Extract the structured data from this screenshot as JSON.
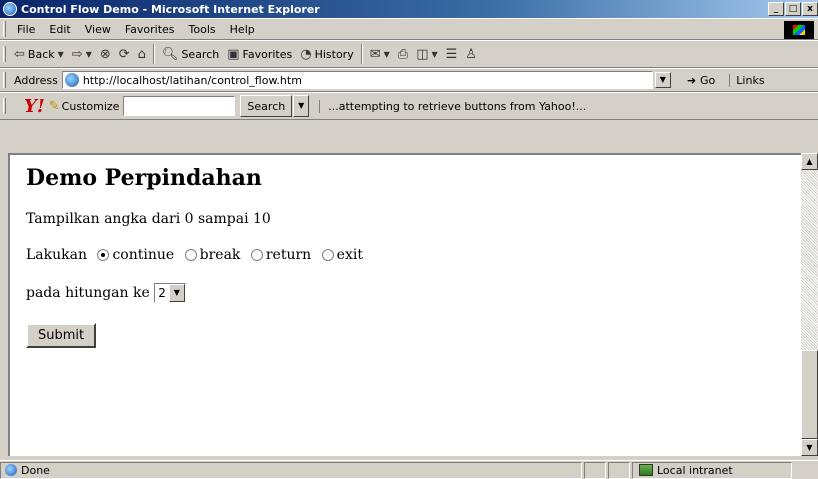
{
  "window": {
    "title": "Control Flow Demo - Microsoft Internet Explorer",
    "minimize": "_",
    "maximize": "□",
    "close": "x"
  },
  "menu": [
    {
      "label": "File"
    },
    {
      "label": "Edit"
    },
    {
      "label": "View"
    },
    {
      "label": "Favorites"
    },
    {
      "label": "Tools"
    },
    {
      "label": "Help"
    }
  ],
  "toolbar": {
    "back": "Back",
    "search": "Search",
    "favorites": "Favorites",
    "history": "History"
  },
  "address": {
    "label": "Address",
    "url": "http://localhost/latihan/control_flow.htm",
    "go": "Go",
    "links": "Links"
  },
  "yahoo": {
    "logo": "Y!",
    "customize": "Customize",
    "search_button": "Search",
    "status": "...attempting to retrieve buttons from Yahoo!..."
  },
  "page": {
    "heading": "Demo Perpindahan",
    "intro": "Tampilkan angka dari 0 sampai 10",
    "action_label": "Lakukan",
    "options": [
      {
        "label": "continue",
        "selected": true
      },
      {
        "label": "break",
        "selected": false
      },
      {
        "label": "return",
        "selected": false
      },
      {
        "label": "exit",
        "selected": false
      }
    ],
    "count_label": "pada hitungan ke",
    "count_value": "2",
    "submit": "Submit"
  },
  "status": {
    "text": "Done",
    "zone": "Local intranet"
  }
}
